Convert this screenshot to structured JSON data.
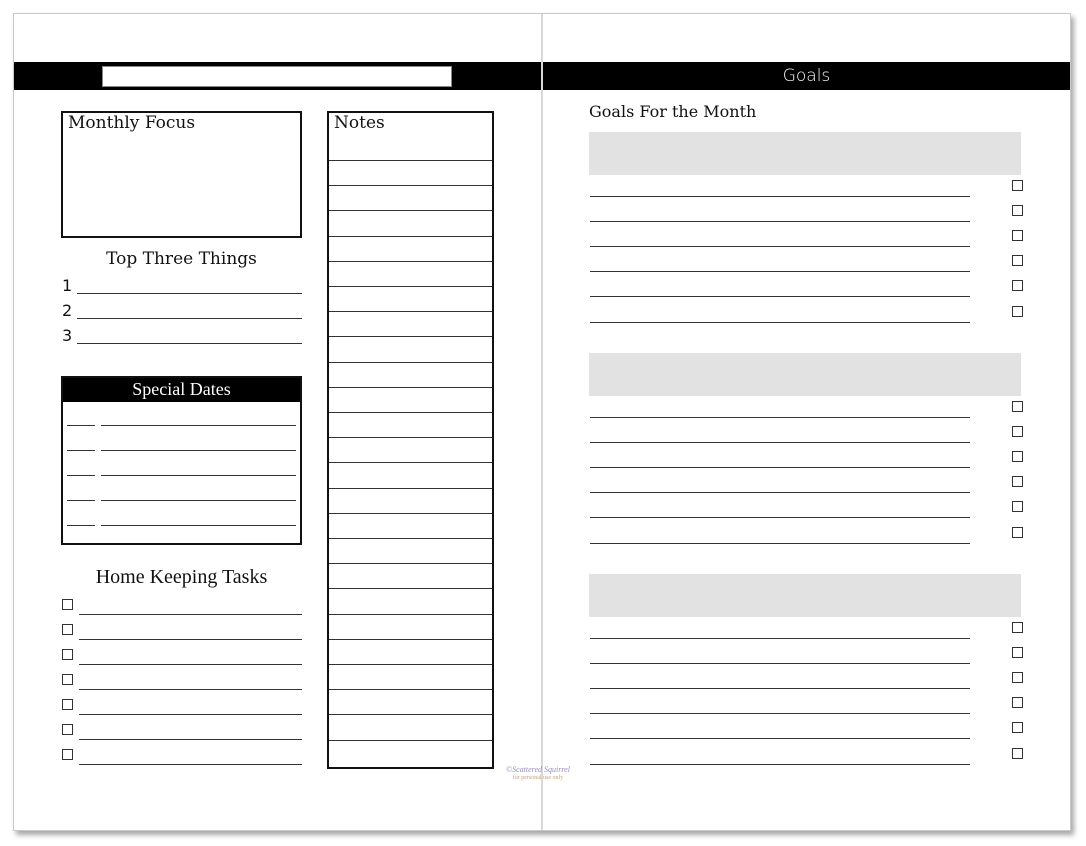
{
  "left_page": {
    "title_field_value": "",
    "monthly_focus": {
      "label": "Monthly Focus"
    },
    "top_three": {
      "heading": "Top Three Things",
      "items": [
        "1",
        "2",
        "3"
      ]
    },
    "special_dates": {
      "heading": "Special Dates",
      "rows": 5
    },
    "home_keeping": {
      "heading": "Home Keeping Tasks",
      "rows": 7
    },
    "notes": {
      "label": "Notes",
      "rows": 24
    },
    "watermark": {
      "line1": "©Scattered Squirrel",
      "line2": "for personal use only"
    }
  },
  "right_page": {
    "band_title": "Goals",
    "heading": "Goals For the Month",
    "goal_blocks": [
      {
        "title": "",
        "lines": 6
      },
      {
        "title": "",
        "lines": 6
      },
      {
        "title": "",
        "lines": 6
      }
    ]
  },
  "colors": {
    "band": "#000000",
    "goal_block": "#e2e2e2",
    "fold": "#d8d8d8"
  }
}
